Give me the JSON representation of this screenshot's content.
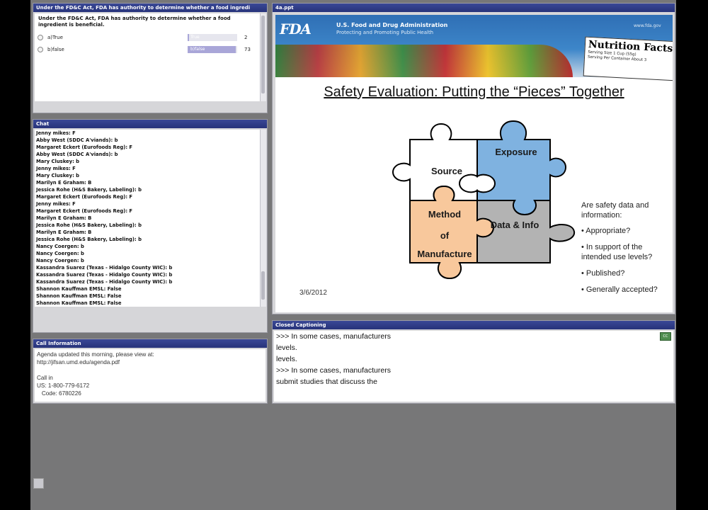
{
  "poll": {
    "title": "Under the FD&C Act, FDA has authority to determine whether a food ingredi",
    "question": "Under the FD&C Act, FDA has authority to determine whether a food ingredient is beneficial.",
    "options": [
      {
        "label": "a)True",
        "bar_text": "True",
        "count": "2",
        "fraction": 0.03
      },
      {
        "label": "b)false",
        "bar_text": "b)false",
        "count": "73",
        "fraction": 0.97
      }
    ]
  },
  "slide_pod": {
    "title": "4a.ppt"
  },
  "slide": {
    "agency_name": "U.S. Food and Drug Administration",
    "agency_sub": "Protecting and Promoting Public Health",
    "logo": "FDA",
    "url": "www.fda.gov",
    "nutrition_title": "Nutrition Facts",
    "nutrition_lines": [
      "Serving Size 1 Cup (55g)",
      "Serving Per Container About 3"
    ],
    "title": "Safety Evaluation: Putting the “Pieces” Together",
    "pieces": {
      "source": "Source",
      "exposure": "Exposure",
      "method_lines": [
        "Method",
        "of",
        "Manufacture"
      ],
      "data": "Data & Info"
    },
    "colors": {
      "exposure": "#7fb2e0",
      "method": "#f8c89c",
      "data": "#b3b3b3",
      "source": "#ffffff"
    },
    "side_items": [
      "Are safety data and information:",
      "• Appropriate?",
      "• In support of the intended use levels?",
      "• Published?",
      "• Generally accepted?"
    ],
    "date": "3/6/2012"
  },
  "chat": {
    "title": "Chat",
    "messages": [
      "Jenny mikes: F",
      "Abby West (SDDC A'viands): b",
      "Margaret Eckert (Eurofoods Reg): F",
      "Abby West (SDDC A'viands): b",
      "Mary Cluskey: b",
      "Jenny mikes: F",
      "Mary Cluskey: b",
      "Marilyn E Graham: B",
      "Jessica Rohe (H&S Bakery, Labeling): b",
      "Margaret Eckert (Eurofoods Reg): F",
      "Jenny mikes: F",
      "Margaret Eckert (Eurofoods Reg): F",
      "Marilyn E Graham: B",
      "Jessica Rohe (H&S Bakery, Labeling): b",
      "Marilyn E Graham: B",
      "Jessica Rohe (H&S Bakery, Labeling): b",
      "Nancy Coergen: b",
      "Nancy Coergen: b",
      "Nancy Coergen: b",
      "Kassandra Suarez (Texas - Hidalgo County WIC): b",
      "Kassandra Suarez (Texas - Hidalgo County WIC): b",
      "Kassandra Suarez (Texas - Hidalgo County WIC): b",
      "Shannon Kauffman EMSL: False",
      "Shannon Kauffman EMSL: False",
      "Shannon Kauffman EMSL: False"
    ]
  },
  "captions": {
    "title": "Closed Captioning",
    "button": "CC",
    "lines": [
      ">>> In some cases, manufacturers",
      "levels.",
      "levels.",
      ">>> In some cases, manufacturers",
      "submit studies that discuss the"
    ]
  },
  "call_info": {
    "title": "Call Information",
    "lines": [
      "Agenda updated this morning, please view at:",
      "http://jifsan.umd.edu/agenda.pdf",
      "",
      "Call in",
      "US: 1-800-779-6172",
      "   Code: 6780226"
    ]
  }
}
